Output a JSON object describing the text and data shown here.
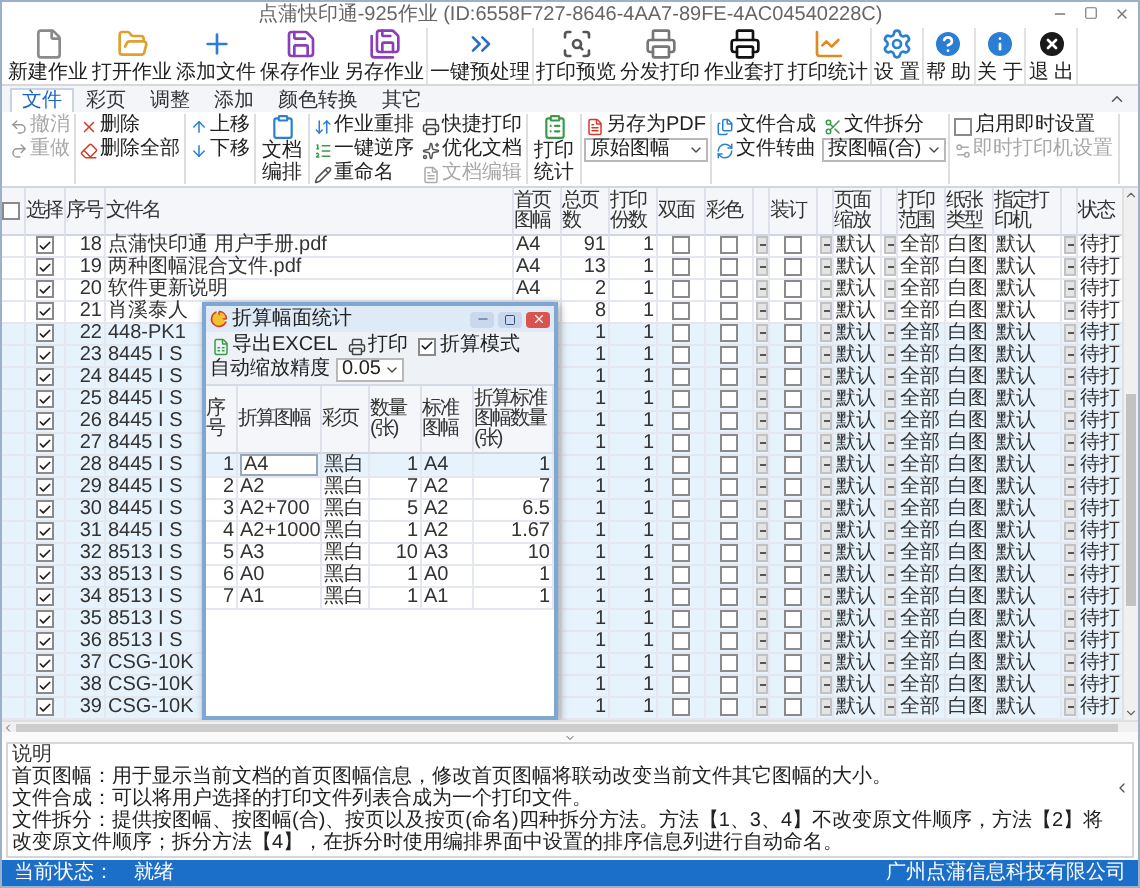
{
  "window": {
    "title": "点蒲快印通-925作业 (ID:6558F727-8646-4AA7-89FE-4AC04540228C)"
  },
  "toolbar": [
    {
      "buttons": [
        {
          "kind": "new",
          "label": "新建作业"
        },
        {
          "kind": "open",
          "label": "打开作业"
        },
        {
          "kind": "add",
          "label": "添加文件"
        },
        {
          "kind": "save",
          "label": "保存作业"
        },
        {
          "kind": "saveas",
          "label": "另存作业"
        }
      ]
    },
    {
      "buttons": [
        {
          "kind": "batch",
          "label": "一键预处理"
        }
      ]
    },
    {
      "buttons": [
        {
          "kind": "preview",
          "label": "打印预览"
        },
        {
          "kind": "distribute",
          "label": "分发打印"
        },
        {
          "kind": "overlay",
          "label": "作业套打"
        },
        {
          "kind": "stats",
          "label": "打印统计"
        }
      ]
    },
    {
      "buttons": [
        {
          "kind": "settings",
          "label": "设 置"
        }
      ]
    },
    {
      "buttons": [
        {
          "kind": "help",
          "label": "帮 助"
        }
      ]
    },
    {
      "buttons": [
        {
          "kind": "about",
          "label": "关 于"
        }
      ]
    },
    {
      "buttons": [
        {
          "kind": "exit",
          "label": "退 出"
        }
      ]
    }
  ],
  "ribbon_tabs": [
    {
      "label": "文件",
      "selected": true
    },
    {
      "label": "彩页",
      "selected": false
    },
    {
      "label": "调整",
      "selected": false
    },
    {
      "label": "添加",
      "selected": false
    },
    {
      "label": "颜色转换",
      "selected": false
    },
    {
      "label": "其它",
      "selected": false
    }
  ],
  "ribbon_groups": [
    {
      "columns": [
        [
          {
            "kind": "undo",
            "label": "撤消",
            "disabled": true
          },
          {
            "kind": "redo",
            "label": "重做",
            "disabled": true
          }
        ]
      ]
    },
    {
      "columns": [
        [
          {
            "kind": "delete",
            "label": "删除",
            "disabled": false
          },
          {
            "kind": "delete_all",
            "label": "删除全部",
            "disabled": false
          }
        ]
      ]
    },
    {
      "columns": [
        [
          {
            "kind": "move_up",
            "label": "上移",
            "disabled": false
          },
          {
            "kind": "move_down",
            "label": "下移",
            "disabled": false
          }
        ]
      ]
    },
    {
      "columns": [
        [
          {
            "kind": "arrange",
            "label": "文档编排",
            "disabled": false
          }
        ]
      ]
    },
    {
      "columns": [
        [
          {
            "kind": "reorder",
            "label": "作业重排",
            "disabled": false
          },
          {
            "kind": "reverse",
            "label": "一键逆序",
            "disabled": false
          },
          {
            "kind": "rename",
            "label": "重命名",
            "disabled": false
          }
        ],
        [
          {
            "kind": "quick_print",
            "label": "快捷打印",
            "disabled": false
          },
          {
            "kind": "optimize",
            "label": "优化文档",
            "disabled": false
          },
          {
            "kind": "edit_doc",
            "label": "文档编辑",
            "disabled": true
          }
        ]
      ]
    },
    {
      "columns": [
        [
          {
            "kind": "print_stats",
            "label": "打印统计",
            "disabled": false
          }
        ]
      ]
    },
    {
      "columns": [
        [
          {
            "kind": "save_pdf",
            "label": "另存为PDF",
            "disabled": false
          },
          {
            "kind": "select",
            "value": "原始图幅"
          }
        ]
      ]
    },
    {
      "columns": [
        [
          {
            "kind": "merge",
            "label": "文件合成",
            "disabled": false
          },
          {
            "kind": "outline",
            "label": "文件转曲",
            "disabled": false
          }
        ],
        [
          {
            "kind": "split",
            "label": "文件拆分",
            "disabled": false
          },
          {
            "kind": "select",
            "value": "按图幅(合)"
          }
        ]
      ]
    },
    {
      "columns": [
        [
          {
            "kind": "checkbox",
            "label": "启用即时设置",
            "checked": false
          },
          {
            "kind": "printer_settings",
            "label": "即时打印机设置",
            "disabled": true
          }
        ]
      ]
    }
  ],
  "table": {
    "select_all_checked": false,
    "columns": [
      "选择",
      "序号",
      "文件名",
      "首页图幅",
      "总页数",
      "打印份数",
      "双面",
      "彩色",
      "装订",
      "页面缩放",
      "打印范围",
      "纸张类型",
      "指定打印机",
      "状态"
    ],
    "rows": [
      {
        "no": "18",
        "checked": true,
        "name": "点蒲快印通 用户手册.pdf",
        "first_page_size": "A4",
        "pages": "91",
        "copies": "1",
        "duplex": false,
        "color_print": false,
        "binding": false,
        "scale": "默认",
        "range": "全部",
        "paper": "白图",
        "printer": "默认",
        "status": "待打",
        "selected": false
      },
      {
        "no": "19",
        "checked": true,
        "name": "两种图幅混合文件.pdf",
        "first_page_size": "A4",
        "pages": "13",
        "copies": "1",
        "duplex": false,
        "color_print": false,
        "binding": false,
        "scale": "默认",
        "range": "全部",
        "paper": "白图",
        "printer": "默认",
        "status": "待打",
        "selected": false
      },
      {
        "no": "20",
        "checked": true,
        "name": "软件更新说明",
        "first_page_size": "A4",
        "pages": "2",
        "copies": "1",
        "duplex": false,
        "color_print": false,
        "binding": false,
        "scale": "默认",
        "range": "全部",
        "paper": "白图",
        "printer": "默认",
        "status": "待打",
        "selected": false
      },
      {
        "no": "21",
        "checked": true,
        "name": "肖溪泰人",
        "pages": "8",
        "copies": "1",
        "duplex": false,
        "color_print": false,
        "binding": false,
        "scale": "默认",
        "range": "全部",
        "paper": "白图",
        "printer": "默认",
        "status": "待打",
        "selected": false
      },
      {
        "no": "22",
        "checked": true,
        "name": "448-PK1",
        "pages": "1",
        "copies": "1",
        "duplex": false,
        "color_print": false,
        "binding": false,
        "scale": "默认",
        "range": "全部",
        "paper": "白图",
        "printer": "默认",
        "status": "待打",
        "selected": true
      },
      {
        "no": "23",
        "checked": true,
        "name": "8445 I S",
        "pages": "1",
        "copies": "1",
        "duplex": false,
        "color_print": false,
        "binding": false,
        "scale": "默认",
        "range": "全部",
        "paper": "白图",
        "printer": "默认",
        "status": "待打",
        "selected": true
      },
      {
        "no": "24",
        "checked": true,
        "name": "8445 I S",
        "pages": "1",
        "copies": "1",
        "duplex": false,
        "color_print": false,
        "binding": false,
        "scale": "默认",
        "range": "全部",
        "paper": "白图",
        "printer": "默认",
        "status": "待打",
        "selected": true
      },
      {
        "no": "25",
        "checked": true,
        "name": "8445 I S",
        "pages": "1",
        "copies": "1",
        "duplex": false,
        "color_print": false,
        "binding": false,
        "scale": "默认",
        "range": "全部",
        "paper": "白图",
        "printer": "默认",
        "status": "待打",
        "selected": true
      },
      {
        "no": "26",
        "checked": true,
        "name": "8445 I S",
        "pages": "1",
        "copies": "1",
        "duplex": false,
        "color_print": false,
        "binding": false,
        "scale": "默认",
        "range": "全部",
        "paper": "白图",
        "printer": "默认",
        "status": "待打",
        "selected": true
      },
      {
        "no": "27",
        "checked": true,
        "name": "8445 I S",
        "pages": "1",
        "copies": "1",
        "duplex": false,
        "color_print": false,
        "binding": false,
        "scale": "默认",
        "range": "全部",
        "paper": "白图",
        "printer": "默认",
        "status": "待打",
        "selected": true
      },
      {
        "no": "28",
        "checked": true,
        "name": "8445 I S",
        "pages": "1",
        "copies": "1",
        "duplex": false,
        "color_print": false,
        "binding": false,
        "scale": "默认",
        "range": "全部",
        "paper": "白图",
        "printer": "默认",
        "status": "待打",
        "selected": true
      },
      {
        "no": "29",
        "checked": true,
        "name": "8445 I S",
        "pages": "1",
        "copies": "1",
        "duplex": false,
        "color_print": false,
        "binding": false,
        "scale": "默认",
        "range": "全部",
        "paper": "白图",
        "printer": "默认",
        "status": "待打",
        "selected": true
      },
      {
        "no": "30",
        "checked": true,
        "name": "8445 I S",
        "pages": "1",
        "copies": "1",
        "duplex": false,
        "color_print": false,
        "binding": false,
        "scale": "默认",
        "range": "全部",
        "paper": "白图",
        "printer": "默认",
        "status": "待打",
        "selected": true
      },
      {
        "no": "31",
        "checked": true,
        "name": "8445 I S",
        "pages": "1",
        "copies": "1",
        "duplex": false,
        "color_print": false,
        "binding": false,
        "scale": "默认",
        "range": "全部",
        "paper": "白图",
        "printer": "默认",
        "status": "待打",
        "selected": true
      },
      {
        "no": "32",
        "checked": true,
        "name": "8513 I S",
        "pages": "1",
        "copies": "1",
        "duplex": false,
        "color_print": false,
        "binding": false,
        "scale": "默认",
        "range": "全部",
        "paper": "白图",
        "printer": "默认",
        "status": "待打",
        "selected": true
      },
      {
        "no": "33",
        "checked": true,
        "name": "8513 I S",
        "pages": "1",
        "copies": "1",
        "duplex": false,
        "color_print": false,
        "binding": false,
        "scale": "默认",
        "range": "全部",
        "paper": "白图",
        "printer": "默认",
        "status": "待打",
        "selected": true
      },
      {
        "no": "34",
        "checked": true,
        "name": "8513 I S",
        "pages": "1",
        "copies": "1",
        "duplex": false,
        "color_print": false,
        "binding": false,
        "scale": "默认",
        "range": "全部",
        "paper": "白图",
        "printer": "默认",
        "status": "待打",
        "selected": true
      },
      {
        "no": "35",
        "checked": true,
        "name": "8513 I S",
        "pages": "1",
        "copies": "1",
        "duplex": false,
        "color_print": false,
        "binding": false,
        "scale": "默认",
        "range": "全部",
        "paper": "白图",
        "printer": "默认",
        "status": "待打",
        "selected": true
      },
      {
        "no": "36",
        "checked": true,
        "name": "8513 I S",
        "pages": "1",
        "copies": "1",
        "duplex": false,
        "color_print": false,
        "binding": false,
        "scale": "默认",
        "range": "全部",
        "paper": "白图",
        "printer": "默认",
        "status": "待打",
        "selected": true
      },
      {
        "no": "37",
        "checked": true,
        "name": "CSG-10K",
        "pages": "1",
        "copies": "1",
        "duplex": false,
        "color_print": false,
        "binding": false,
        "scale": "默认",
        "range": "全部",
        "paper": "白图",
        "printer": "默认",
        "status": "待打",
        "selected": true
      },
      {
        "no": "38",
        "checked": true,
        "name": "CSG-10K",
        "pages": "1",
        "copies": "1",
        "duplex": false,
        "color_print": false,
        "binding": false,
        "scale": "默认",
        "range": "全部",
        "paper": "白图",
        "printer": "默认",
        "status": "待打",
        "selected": true
      },
      {
        "no": "39",
        "checked": true,
        "name": "CSG-10K",
        "pages": "1",
        "copies": "1",
        "duplex": false,
        "color_print": false,
        "binding": false,
        "scale": "默认",
        "range": "全部",
        "paper": "白图",
        "printer": "默认",
        "status": "待打",
        "selected": true
      }
    ]
  },
  "dialog": {
    "title": "折算幅面统计",
    "export_label": "导出EXCEL",
    "print_label": "打印",
    "mode_label": "折算模式",
    "mode_checked": true,
    "precision_label": "自动缩放精度",
    "precision_value": "0.05",
    "columns": [
      "序号",
      "折算图幅",
      "彩页",
      "数量(张)",
      "标准图幅",
      "折算标准图幅数量(张)"
    ],
    "rows": [
      {
        "no": "1",
        "size": "A4",
        "color_mode": "黑白",
        "count": "1",
        "standard": "A4",
        "converted": "1",
        "selected": true
      },
      {
        "no": "2",
        "size": "A2",
        "color_mode": "黑白",
        "count": "7",
        "standard": "A2",
        "converted": "7",
        "selected": false
      },
      {
        "no": "3",
        "size": "A2+700",
        "color_mode": "黑白",
        "count": "5",
        "standard": "A2",
        "converted": "6.5",
        "selected": false
      },
      {
        "no": "4",
        "size": "A2+1000",
        "color_mode": "黑白",
        "count": "1",
        "standard": "A2",
        "converted": "1.67",
        "selected": false
      },
      {
        "no": "5",
        "size": "A3",
        "color_mode": "黑白",
        "count": "10",
        "standard": "A3",
        "converted": "10",
        "selected": false
      },
      {
        "no": "6",
        "size": "A0",
        "color_mode": "黑白",
        "count": "1",
        "standard": "A0",
        "converted": "1",
        "selected": false
      },
      {
        "no": "7",
        "size": "A1",
        "color_mode": "黑白",
        "count": "1",
        "standard": "A1",
        "converted": "1",
        "selected": false
      }
    ]
  },
  "notes": {
    "title": "说明",
    "lines": [
      "首页图幅：用于显示当前文档的首页图幅信息，修改首页图幅将联动改变当前文件其它图幅的大小。",
      "文件合成：可以将用户选择的打印文件列表合成为一个打印文件。",
      "文件拆分：提供按图幅、按图幅(合)、按页以及按页(命名)四种拆分方法。方法【1、3、4】不改变原文件顺序，方法【2】将改变原文件顺序；拆分方法【4】，在拆分时使用编排界面中设置的排序信息列进行自动命名。"
    ]
  },
  "status_bar": {
    "label": "当前状态：",
    "value": "就绪",
    "company": "广州点蒲信息科技有限公司"
  }
}
